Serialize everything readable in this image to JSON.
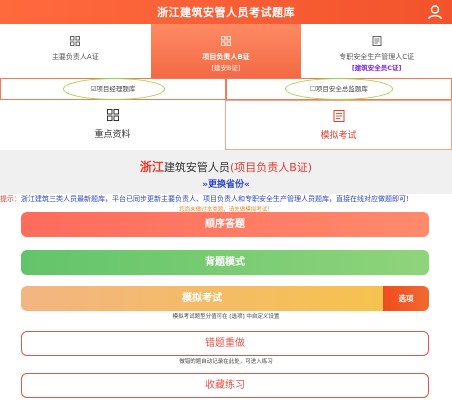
{
  "header": {
    "title": "浙江建筑安管人员考试题库",
    "user_icon": "user-icon"
  },
  "certs": [
    {
      "label": "主要负责人A证",
      "sub": "",
      "icon": "grid-icon"
    },
    {
      "label": "项目负责人B证",
      "sub": "[建安B证]",
      "icon": "grid-icon"
    },
    {
      "label": "专职安全生产管理人C证",
      "sub": "[建筑安全员C证]",
      "icon": "document-icon"
    }
  ],
  "subtabs": [
    "☑项目经理题库",
    "☐项目安全总监题库"
  ],
  "modes": [
    {
      "label": "重点资料",
      "icon": "grid-icon"
    },
    {
      "label": "模拟考试",
      "icon": "document-icon"
    }
  ],
  "banner": {
    "province": "浙江",
    "prefix": "建筑安管人员",
    "role": "(项目负责人B证)",
    "change_link": "»更换省份«"
  },
  "tip": {
    "prefix": "提示：",
    "text": "浙江建筑三类人员最新题库，平台已同步更新主要负责人、项目负责人和专职安全生产管理人员题库，直接在线对应做题即可!"
  },
  "warning": "您尚未做过本类题，请先做模拟考试！",
  "buttons": {
    "sequential": "顺序答题",
    "memorize": "背题模式",
    "exam": "模拟考试",
    "options": "选项",
    "exam_note": "模拟考试题型分值可在 [选项] 中自定义设置",
    "mistakes": "错题重做",
    "mistakes_note": "做错的题自动记录在此处，可进入练习",
    "favorites": "收藏练习"
  },
  "colors": {
    "accent": "#f2532c",
    "blue": "#2b46c9",
    "green": "#62c46a",
    "purple": "#7a2bd6"
  }
}
